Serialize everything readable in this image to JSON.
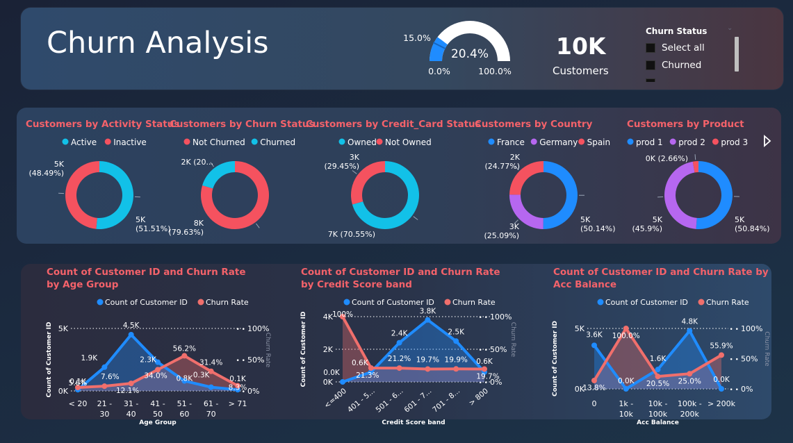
{
  "header": {
    "title": "Churn Analysis",
    "gauge": {
      "value_label": "20.4%",
      "value": 20.4,
      "target_label": "15.0%",
      "target": 15.0,
      "min_label": "0.0%",
      "max_label": "100.0%",
      "min": 0,
      "max": 100
    },
    "kpi": {
      "value": "10K",
      "label": "Customers"
    },
    "slicer": {
      "title": "Churn Status",
      "items": [
        "Select all",
        "Churned"
      ]
    }
  },
  "colors": {
    "blue": "#1f8cff",
    "cyan": "#12c1e8",
    "red": "#f5525f",
    "purple": "#b667f0",
    "salmon": "#f06f6c",
    "title": "#f4626a"
  },
  "nav_icon": "play-arrow-icon",
  "chart_data": [
    {
      "type": "pie",
      "title": "Customers by Activity Status",
      "legend": [
        "Active",
        "Inactive"
      ],
      "slices": [
        {
          "name": "Active",
          "value": 51.51,
          "label": "5K\n(51.51%)"
        },
        {
          "name": "Inactive",
          "value": 48.49,
          "label": "5K\n(48.49%)"
        }
      ]
    },
    {
      "type": "pie",
      "title": "Customers by Churn Status",
      "legend": [
        "Not Churned",
        "Churned"
      ],
      "slices": [
        {
          "name": "Not Churned",
          "value": 79.63,
          "label": "8K\n(79.63%)"
        },
        {
          "name": "Churned",
          "value": 20.37,
          "label": "2K (20..."
        }
      ]
    },
    {
      "type": "pie",
      "title": "Customers by Credit_Card Status",
      "legend": [
        "Owned",
        "Not Owned"
      ],
      "slices": [
        {
          "name": "Owned",
          "value": 70.55,
          "label": "7K (70.55%)"
        },
        {
          "name": "Not Owned",
          "value": 29.45,
          "label": "3K\n(29.45%)"
        }
      ]
    },
    {
      "type": "pie",
      "title": "Customers by Country",
      "legend": [
        "France",
        "Germany",
        "Spain"
      ],
      "slices": [
        {
          "name": "France",
          "value": 50.14,
          "label": "5K\n(50.14%)"
        },
        {
          "name": "Germany",
          "value": 25.09,
          "label": "3K\n(25.09%)"
        },
        {
          "name": "Spain",
          "value": 24.77,
          "label": "2K\n(24.77%)"
        }
      ]
    },
    {
      "type": "pie",
      "title": "Customers by Product",
      "legend": [
        "prod 1",
        "prod 2",
        "prod 3"
      ],
      "slices": [
        {
          "name": "prod 1",
          "value": 50.84,
          "label": "5K\n(50.84%)"
        },
        {
          "name": "prod 2",
          "value": 45.9,
          "label": "5K\n(45.9%)"
        },
        {
          "name": "prod 3",
          "value": 2.66,
          "label": "0K (2.66%)"
        }
      ]
    },
    {
      "type": "line",
      "title": "Count of Customer ID and Churn Rate by Age Group",
      "legend": [
        "Count of Customer ID",
        "Churn Rate"
      ],
      "categories": [
        "< 20",
        "21 - 30",
        "31 - 40",
        "41 - 50",
        "51 - 60",
        "61 - 70",
        "> 71"
      ],
      "xlabel": "Age Group",
      "ylabel": "Count of Customer ID",
      "y2label": "Churn Rate",
      "yticks": [
        "0K",
        "5K"
      ],
      "ylim": [
        0,
        5000
      ],
      "y2ticks": [
        "0%",
        "50%",
        "100%"
      ],
      "y2lim": [
        0,
        100
      ],
      "series": [
        {
          "name": "Count of Customer ID",
          "values": [
            100,
            1900,
            4500,
            2300,
            800,
            300,
            100
          ],
          "labels": [
            "0.1K",
            "1.9K",
            "4.5K",
            "2.3K",
            "0.8K",
            "0.3K",
            "0.1K"
          ]
        },
        {
          "name": "Churn Rate",
          "values": [
            5.6,
            7.6,
            12.1,
            34.0,
            56.2,
            31.4,
            8.3
          ],
          "labels": [
            "5.6%",
            "7.6%",
            "12.1%",
            "34.0%",
            "56.2%",
            "31.4%",
            "8.3%"
          ]
        }
      ]
    },
    {
      "type": "line",
      "title": "Count of Customer ID and Churn Rate by Credit Score band",
      "legend": [
        "Count of Customer ID",
        "Churn Rate"
      ],
      "categories": [
        "<=400",
        "401 - 5...",
        "501 - 6...",
        "601 - 7...",
        "701 - 8...",
        "> 800"
      ],
      "xlabel": "Credit Score band",
      "ylabel": "Count of Customer ID",
      "y2label": "Churn Rate",
      "yticks": [
        "0K",
        "2K",
        "4K"
      ],
      "ylim": [
        0,
        4000
      ],
      "y2ticks": [
        "0%",
        "50%",
        "100%"
      ],
      "y2lim": [
        0,
        100
      ],
      "series": [
        {
          "name": "Count of Customer ID",
          "values": [
            0,
            600,
            2400,
            3800,
            2500,
            600
          ],
          "labels": [
            "0.0K",
            "0.6K",
            "2.4K",
            "3.8K",
            "2.5K",
            "0.6K"
          ]
        },
        {
          "name": "Churn Rate",
          "values": [
            100,
            21.3,
            21.2,
            19.7,
            19.9,
            19.7
          ],
          "labels": [
            "100%",
            "21.3%",
            "21.2%",
            "19.7%",
            "19.9%",
            "19.7%"
          ]
        }
      ]
    },
    {
      "type": "line",
      "title": "Count of Customer ID and Churn Rate by Acc Balance",
      "legend": [
        "Count of Customer ID",
        "Churn Rate"
      ],
      "categories": [
        "0",
        "1k - 10k",
        "10k - 100k",
        "100k - 200k",
        "> 200k"
      ],
      "xlabel": "Acc Balance",
      "ylabel": "Count of Customer ID",
      "y2label": "Churn Rate",
      "yticks": [
        "0K",
        "5K"
      ],
      "ylim": [
        0,
        5000
      ],
      "y2ticks": [
        "0%",
        "50%",
        "100%"
      ],
      "y2lim": [
        0,
        100
      ],
      "series": [
        {
          "name": "Count of Customer ID",
          "values": [
            3600,
            0,
            1600,
            4800,
            0
          ],
          "labels": [
            "3.6K",
            "0.0K",
            "1.6K",
            "4.8K",
            "0.0K"
          ]
        },
        {
          "name": "Churn Rate",
          "values": [
            13.8,
            100,
            20.5,
            25.0,
            55.9
          ],
          "labels": [
            "13.8%",
            "100.0%",
            "20.5%",
            "25.0%",
            "55.9%"
          ]
        }
      ]
    }
  ]
}
